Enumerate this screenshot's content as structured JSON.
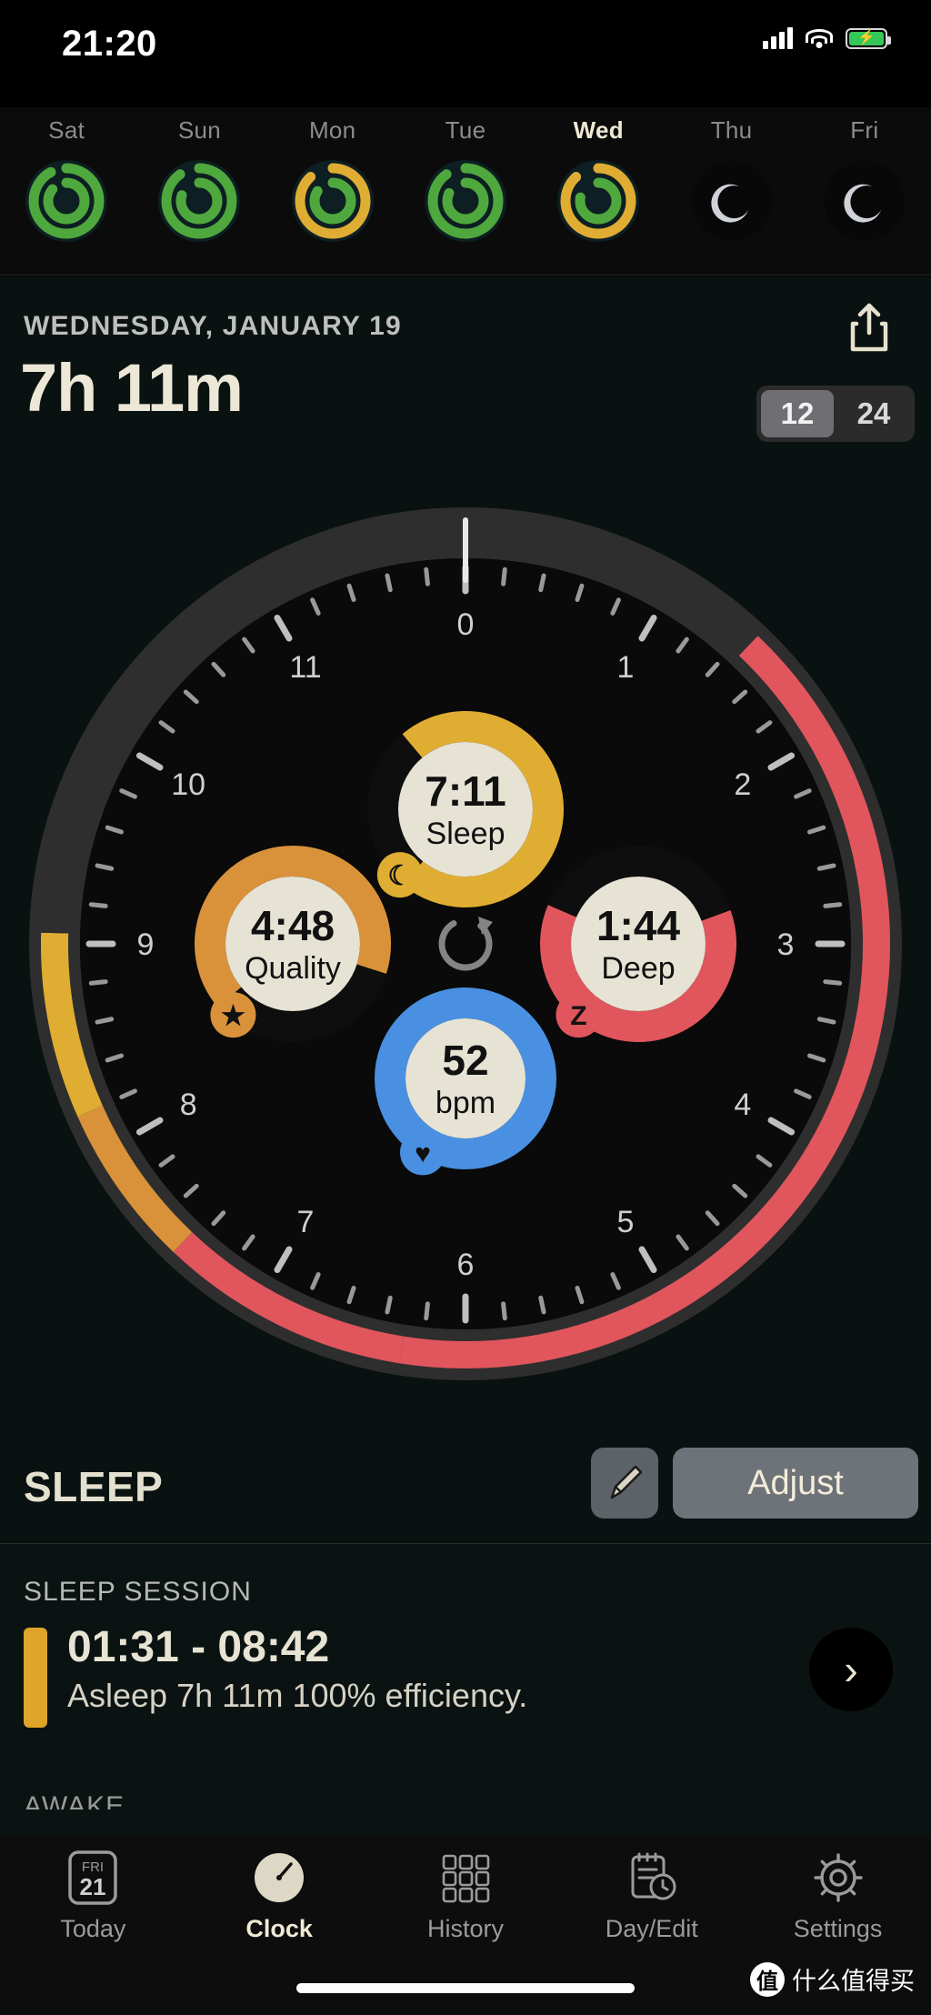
{
  "status_bar": {
    "time": "21:20",
    "signal_icon": "cellular-signal-icon",
    "wifi_icon": "wifi-icon",
    "battery_icon": "battery-charging-icon",
    "battery_color": "#34c759"
  },
  "week_strip": {
    "days": [
      {
        "label": "Sat",
        "selected": false,
        "type": "ring",
        "outer_color": "#4fa83d",
        "inner_color": "#4fa83d",
        "outer_pct": 92,
        "inner_pct": 86
      },
      {
        "label": "Sun",
        "selected": false,
        "type": "ring",
        "outer_color": "#4fa83d",
        "inner_color": "#4fa83d",
        "outer_pct": 90,
        "inner_pct": 80
      },
      {
        "label": "Mon",
        "selected": false,
        "type": "ring",
        "outer_color": "#e0ad33",
        "inner_color": "#4fa83d",
        "outer_pct": 88,
        "inner_pct": 84
      },
      {
        "label": "Tue",
        "selected": false,
        "type": "ring",
        "outer_color": "#4fa83d",
        "inner_color": "#4fa83d",
        "outer_pct": 90,
        "inner_pct": 82
      },
      {
        "label": "Wed",
        "selected": true,
        "type": "ring",
        "outer_color": "#e0ad33",
        "inner_color": "#4fa83d",
        "outer_pct": 88,
        "inner_pct": 78
      },
      {
        "label": "Thu",
        "selected": false,
        "type": "moon",
        "moon_icon": "moon-icon"
      },
      {
        "label": "Fri",
        "selected": false,
        "type": "moon",
        "moon_icon": "moon-icon"
      }
    ]
  },
  "date_header": {
    "date": "WEDNESDAY, JANUARY 19",
    "duration": "7h 11m",
    "share_icon": "share-icon",
    "hour_format": {
      "options": [
        "12",
        "24"
      ],
      "selected": "12"
    }
  },
  "dial": {
    "hour_labels": [
      "0",
      "1",
      "2",
      "3",
      "4",
      "5",
      "6",
      "7",
      "8",
      "9",
      "10",
      "11"
    ],
    "track_segments": [
      {
        "name": "awake-red-evening",
        "color": "#e0565c",
        "from_hour": 1.45,
        "to_hour": 6.3
      },
      {
        "name": "awake-red-morning",
        "color": "#e0565c",
        "from_hour": 6.3,
        "to_hour": 7.45
      },
      {
        "name": "sleep-orange",
        "color": "#d9923a",
        "from_hour": 7.45,
        "to_hour": 8.2
      },
      {
        "name": "sleep-yellow",
        "color": "#e0ad33",
        "from_hour": 8.2,
        "to_hour": 9.05
      },
      {
        "name": "empty-dark",
        "color": "#2e2e2e",
        "from_hour": 9.05,
        "to_hour": 13.45
      }
    ],
    "refresh_icon": "refresh-icon",
    "bubbles": [
      {
        "name": "sleep",
        "value": "7:11",
        "label": "Sleep",
        "ring_color": "#e0ad33",
        "badge_icon": "moon-icon",
        "badge_glyph": "☾",
        "arc_pct": 72
      },
      {
        "name": "quality",
        "value": "4:48",
        "label": "Quality",
        "ring_color": "#d9923a",
        "badge_icon": "star-icon",
        "badge_glyph": "★",
        "arc_pct": 66
      },
      {
        "name": "deep",
        "value": "1:44",
        "label": "Deep",
        "ring_color": "#e0565c",
        "badge_icon": "z-icon",
        "badge_glyph": "Z",
        "arc_pct": 62
      },
      {
        "name": "heart-rate",
        "value": "52",
        "label": "bpm",
        "ring_color": "#4a90e2",
        "badge_icon": "heart-icon",
        "badge_glyph": "♥",
        "arc_pct": 100
      }
    ]
  },
  "sleep_section": {
    "title": "SLEEP",
    "pencil_icon": "pencil-icon",
    "adjust_label": "Adjust"
  },
  "sessions": {
    "heading": "SLEEP SESSION",
    "rows": [
      {
        "time_range": "01:31 - 08:42",
        "detail": "Asleep 7h 11m 100% efficiency.",
        "bar_color": "#dfa42a",
        "chevron_icon": "chevron-right-icon"
      }
    ],
    "next_heading_peek": "AWAKE"
  },
  "tab_bar": {
    "tabs": [
      {
        "label": "Today",
        "icon": "calendar-icon",
        "icon_top": "FRI",
        "icon_day": "21",
        "active": false
      },
      {
        "label": "Clock",
        "icon": "clock-dial-icon",
        "active": true
      },
      {
        "label": "History",
        "icon": "grid-icon",
        "active": false
      },
      {
        "label": "Day/Edit",
        "icon": "clipboard-clock-icon",
        "active": false
      },
      {
        "label": "Settings",
        "icon": "gear-icon",
        "active": false
      }
    ],
    "home_indicator": "home-indicator"
  },
  "watermark": {
    "badge": "值",
    "text": "什么值得买"
  }
}
